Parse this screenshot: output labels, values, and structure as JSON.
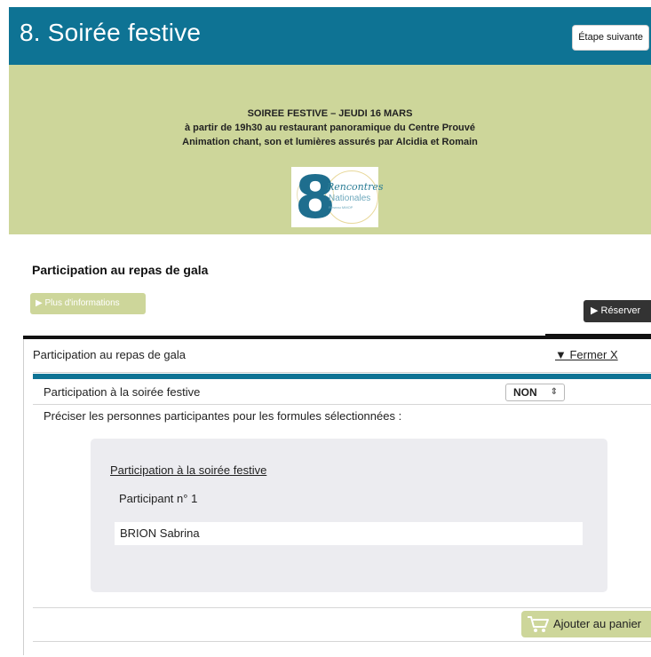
{
  "header": {
    "title": "8. Soirée festive",
    "next_label": "Étape suivante"
  },
  "banner": {
    "line1": "SOIREE FESTIVE – JEUDI 16 MARS",
    "line2": "à partir de 19h30 au restaurant panoramique du Centre Prouvé",
    "line3": "Animation chant, son et lumières assurés par Alcidia et Romain",
    "logo": {
      "number": "8",
      "script": "Rencontres",
      "word": "Nationales",
      "tiny": "Réseau MMOP"
    }
  },
  "section": {
    "title": "Participation au repas de gala",
    "more_info": "Plus d'informations",
    "reserve": "Réserver"
  },
  "panel": {
    "heading": "Participation au repas de gala",
    "close": "▼ Fermer  X",
    "option_label": "Participation à la soirée festive",
    "option_value": "NON",
    "instructions": "Préciser les personnes participantes pour les formules sélectionnées :",
    "card": {
      "title": "Participation à la soirée festive",
      "participant_label": "Participant n° 1",
      "participant_value": "BRION Sabrina"
    },
    "cart_label": "Ajouter au panier"
  },
  "colors": {
    "header_bg": "#0e7394",
    "banner_bg": "#cdd69a",
    "button_dark": "#333333"
  },
  "icons": [
    "play-icon",
    "cart-icon",
    "updown-arrows-icon"
  ]
}
